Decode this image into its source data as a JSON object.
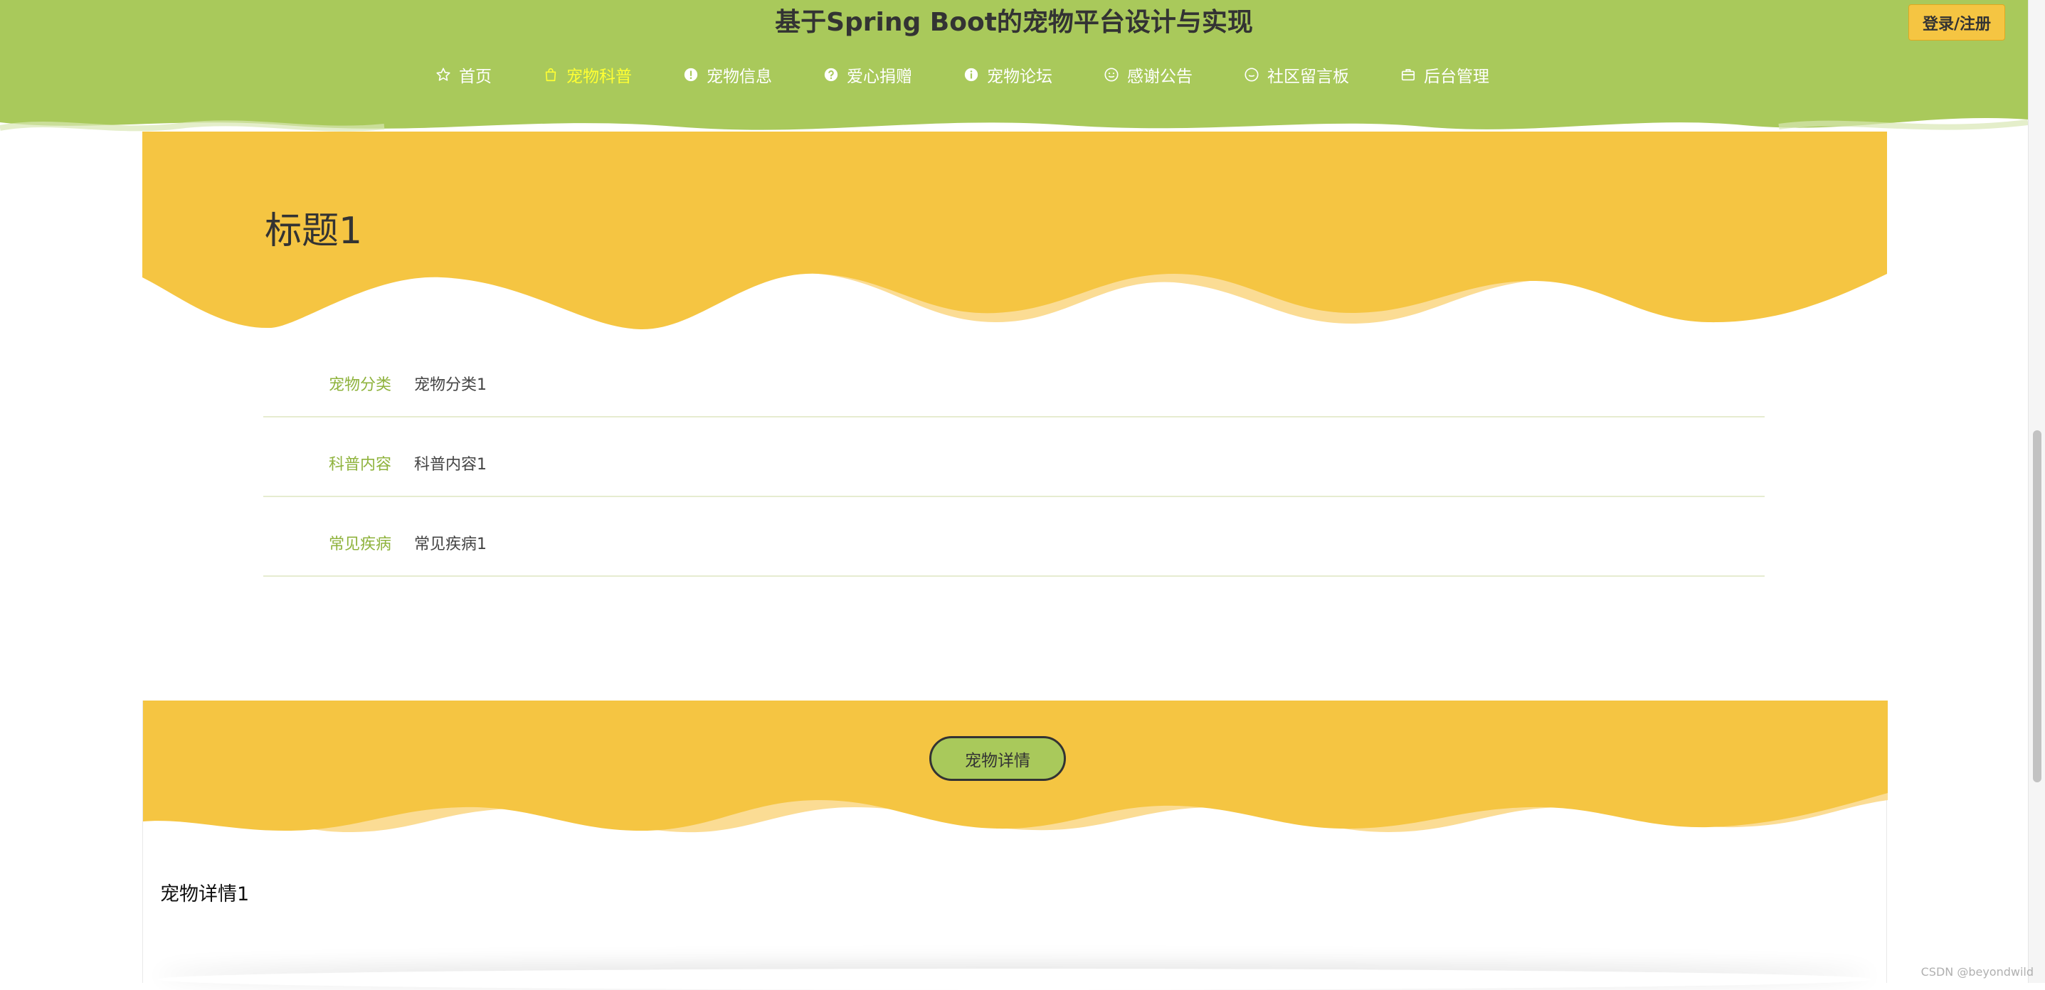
{
  "header": {
    "title": "基于Spring Boot的宠物平台设计与实现",
    "login_label": "登录/注册",
    "nav": [
      {
        "label": "首页",
        "icon": "star-icon"
      },
      {
        "label": "宠物科普",
        "icon": "bag-icon",
        "active": true
      },
      {
        "label": "宠物信息",
        "icon": "info-circle-icon"
      },
      {
        "label": "爱心捐赠",
        "icon": "question-circle-icon"
      },
      {
        "label": "宠物论坛",
        "icon": "info-circle-icon"
      },
      {
        "label": "感谢公告",
        "icon": "smile-icon"
      },
      {
        "label": "社区留言板",
        "icon": "message-icon"
      },
      {
        "label": "后台管理",
        "icon": "briefcase-icon"
      }
    ]
  },
  "detail": {
    "title": "标题1",
    "fields": [
      {
        "label": "宠物分类",
        "value": "宠物分类1"
      },
      {
        "label": "科普内容",
        "value": "科普内容1"
      },
      {
        "label": "常见疾病",
        "value": "常见疾病1"
      }
    ]
  },
  "pet_section": {
    "button_label": "宠物详情",
    "content": "宠物详情1"
  },
  "watermark": "CSDN @beyondwild",
  "colors": {
    "header_green": "#a9c95b",
    "accent_yellow": "#f5c542",
    "active_nav": "#ffff33",
    "label_green": "#8fb33d"
  }
}
